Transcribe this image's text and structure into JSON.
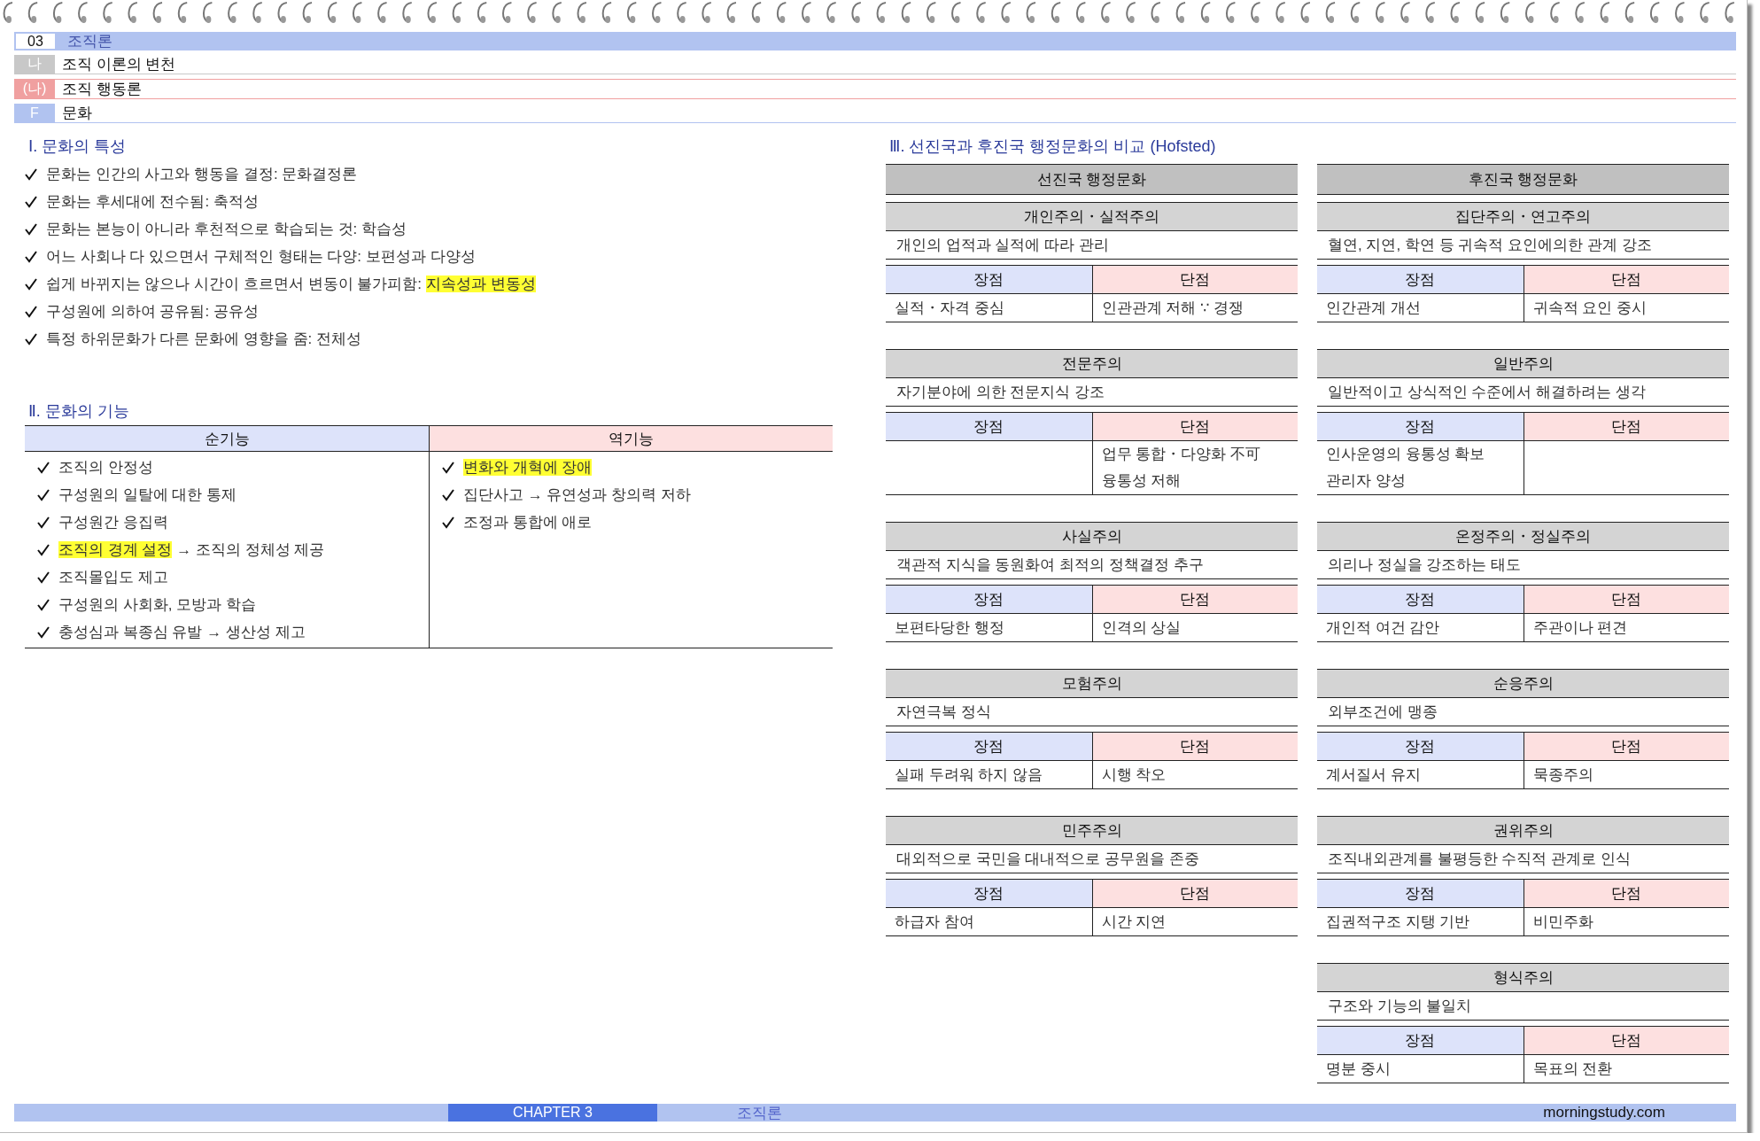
{
  "chapter": {
    "number": "03",
    "title": "조직론"
  },
  "breadcrumbs": [
    {
      "marker": "나",
      "label": "조직 이론의 변천",
      "kind": "gray"
    },
    {
      "marker": "(나)",
      "label": "조직 행동론",
      "kind": "red"
    },
    {
      "marker": "F",
      "label": "문화",
      "kind": "blue"
    }
  ],
  "characteristics": {
    "title": "Ⅰ. 문화의 특성",
    "items": [
      [
        {
          "text": "문화는 인간의 사고와 행동을 결정: 문화결정론",
          "highlighted": false
        }
      ],
      [
        {
          "text": "문화는 후세대에 전수됨: 축적성",
          "highlighted": false
        }
      ],
      [
        {
          "text": "문화는 본능이 아니라 후천적으로 학습되는 것: 학습성",
          "highlighted": false
        }
      ],
      [
        {
          "text": "어느 사회나 다 있으면서 구체적인 형태는 다양: 보편성과 다양성",
          "highlighted": false
        }
      ],
      [
        {
          "text": "쉽게 바뀌지는 않으나 시간이 흐르면서 변동이 불가피함: ",
          "highlighted": false
        },
        {
          "text": "지속성과 변동성",
          "highlighted": true
        }
      ],
      [
        {
          "text": "구성원에 의하여 공유됨: 공유성",
          "highlighted": false
        }
      ],
      [
        {
          "text": "특정 하위문화가 다른 문화에 영향을 줌: 전체성",
          "highlighted": false
        }
      ]
    ]
  },
  "functions": {
    "title": "Ⅱ. 문화의 기능",
    "columns": [
      {
        "label": "순기능",
        "kind": "positive",
        "items": [
          [
            {
              "text": "조직의 안정성",
              "highlighted": false
            }
          ],
          [
            {
              "text": "구성원의 일탈에 대한 통제",
              "highlighted": false
            }
          ],
          [
            {
              "text": "구성원간 응집력",
              "highlighted": false
            }
          ],
          [
            {
              "text": "조직의 경계 설정",
              "highlighted": true
            },
            {
              "text": " → 조직의 정체성 제공",
              "highlighted": false
            }
          ],
          [
            {
              "text": "조직몰입도 제고",
              "highlighted": false
            }
          ],
          [
            {
              "text": "구성원의 사회화, 모방과 학습",
              "highlighted": false
            }
          ],
          [
            {
              "text": "충성심과 복종심 유발 → 생산성 제고",
              "highlighted": false
            }
          ]
        ]
      },
      {
        "label": "역기능",
        "kind": "negative",
        "items": [
          [
            {
              "text": "변화와 개혁에 장애",
              "highlighted": true
            }
          ],
          [
            {
              "text": "집단사고 → 유연성과 창의력 저하",
              "highlighted": false
            }
          ],
          [
            {
              "text": "조정과 통합에 애로",
              "highlighted": false
            }
          ]
        ]
      }
    ]
  },
  "comparison": {
    "title": "Ⅲ. 선진국과 후진국 행정문화의 비교 (Hofsted)",
    "columns": [
      {
        "heading": "선진국 행정문화",
        "cards": [
          {
            "heading": "개인주의・실적주의",
            "description": "개인의 업적과 실적에 따라 관리",
            "pros_label": "장점",
            "cons_label": "단점",
            "pros": [
              "실적・자격 중심"
            ],
            "cons": [
              "인관관계 저해 ∵ 경쟁"
            ]
          },
          {
            "heading": "전문주의",
            "description": "자기분야에 의한 전문지식 강조",
            "pros_label": "장점",
            "cons_label": "단점",
            "cons": [
              "업무 통합・다양화 不可",
              "융통성 저해"
            ]
          },
          {
            "heading": "사실주의",
            "description": "객관적 지식을 동원화여 최적의 정책결정 추구",
            "pros_label": "장점",
            "cons_label": "단점",
            "pros": [
              "보편타당한 행정"
            ],
            "cons": [
              "인격의 상실"
            ]
          },
          {
            "heading": "모험주의",
            "description": "자연극복 정식",
            "pros_label": "장점",
            "cons_label": "단점",
            "pros": [
              "실패 두려워 하지 않음"
            ],
            "cons": [
              "시행 착오"
            ]
          },
          {
            "heading": "민주주의",
            "description": "대외적으로 국민을 대내적으로 공무원을 존중",
            "pros_label": "장점",
            "cons_label": "단점",
            "pros": [
              "하급자 참여"
            ],
            "cons": [
              "시간 지연"
            ]
          }
        ]
      },
      {
        "heading": "후진국 행정문화",
        "cards": [
          {
            "heading": "집단주의・연고주의",
            "description": "혈연, 지연, 학연 등 귀속적 요인에의한 관계 강조",
            "pros_label": "장점",
            "cons_label": "단점",
            "pros": [
              "인간관계 개선"
            ],
            "cons": [
              "귀속적 요인 중시"
            ]
          },
          {
            "heading": "일반주의",
            "description": "일반적이고 상식적인 수준에서 해결하려는 생각",
            "pros_label": "장점",
            "cons_label": "단점",
            "pros": [
              "인사운영의 융통성 확보",
              "관리자 양성"
            ]
          },
          {
            "heading": "온정주의・정실주의",
            "description": "의리나 정실을 강조하는 태도",
            "pros_label": "장점",
            "cons_label": "단점",
            "pros": [
              "개인적 여건 감안"
            ],
            "cons": [
              "주관이나 편견"
            ]
          },
          {
            "heading": "순응주의",
            "description": "외부조건에 맹종",
            "pros_label": "장점",
            "cons_label": "단점",
            "pros": [
              "계서질서 유지"
            ],
            "cons": [
              "묵종주의"
            ]
          },
          {
            "heading": "권위주의",
            "description": "조직내외관계를 불평등한 수직적 관계로 인식",
            "pros_label": "장점",
            "cons_label": "단점",
            "pros": [
              "집권적구조 지탱 기반"
            ],
            "cons": [
              "비민주화"
            ]
          },
          {
            "heading": "형식주의",
            "description": "구조와 기능의 불일치",
            "pros_label": "장점",
            "cons_label": "단점",
            "pros": [
              "명분 중시"
            ],
            "cons": [
              "목표의 전환"
            ]
          }
        ]
      }
    ]
  },
  "footer": {
    "chapter_label": "CHAPTER 3",
    "title": "조직론",
    "site": "morningstudy.com"
  }
}
